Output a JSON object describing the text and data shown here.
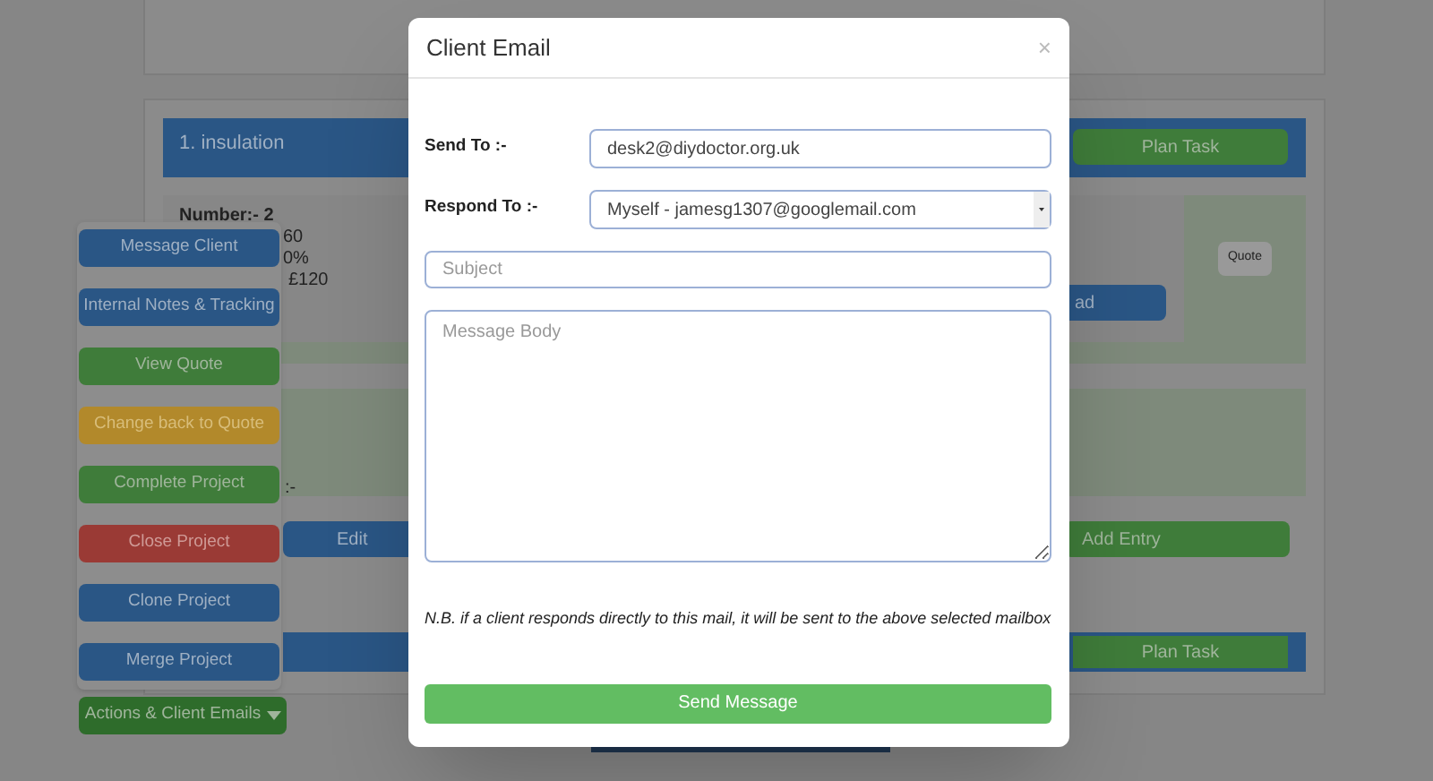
{
  "background": {
    "task": {
      "title": "1. insulation",
      "plan_button": "Plan Task",
      "details": [
        "Number:- 2",
        "60",
        "0%",
        "£120"
      ],
      "load_button": "ad",
      "quote_button": "Quote"
    },
    "label_fragment": ":-",
    "edit_button": "Edit",
    "add_entry_button": "Add Entry",
    "task_2": {
      "plan_button": "Plan Task"
    }
  },
  "actions_menu": {
    "items": [
      {
        "label": "Message Client",
        "kind": "primary"
      },
      {
        "label": "Internal Notes & Tracking",
        "kind": "primary"
      },
      {
        "label": "View Quote",
        "kind": "success"
      },
      {
        "label": "Change back to Quote",
        "kind": "warning"
      },
      {
        "label": "Complete Project",
        "kind": "success"
      },
      {
        "label": "Close Project",
        "kind": "danger"
      },
      {
        "label": "Clone Project",
        "kind": "primary"
      },
      {
        "label": "Merge Project",
        "kind": "primary"
      }
    ],
    "toggle": "Actions & Client Emails"
  },
  "modal": {
    "title": "Client Email",
    "close": "×",
    "fields": [
      {
        "label": "Send To :-",
        "kind": "input",
        "value": "desk2@diydoctor.org.uk"
      },
      {
        "label": "Respond To :-",
        "kind": "select",
        "value": "Myself - jamesg1307@googlemail.com"
      }
    ],
    "subject": {
      "placeholder": "Subject"
    },
    "body": {
      "placeholder": "Message Body"
    },
    "note": "N.B. if a client responds directly to this mail, it will be sent to the above selected mailbox",
    "submit": "Send Message"
  }
}
